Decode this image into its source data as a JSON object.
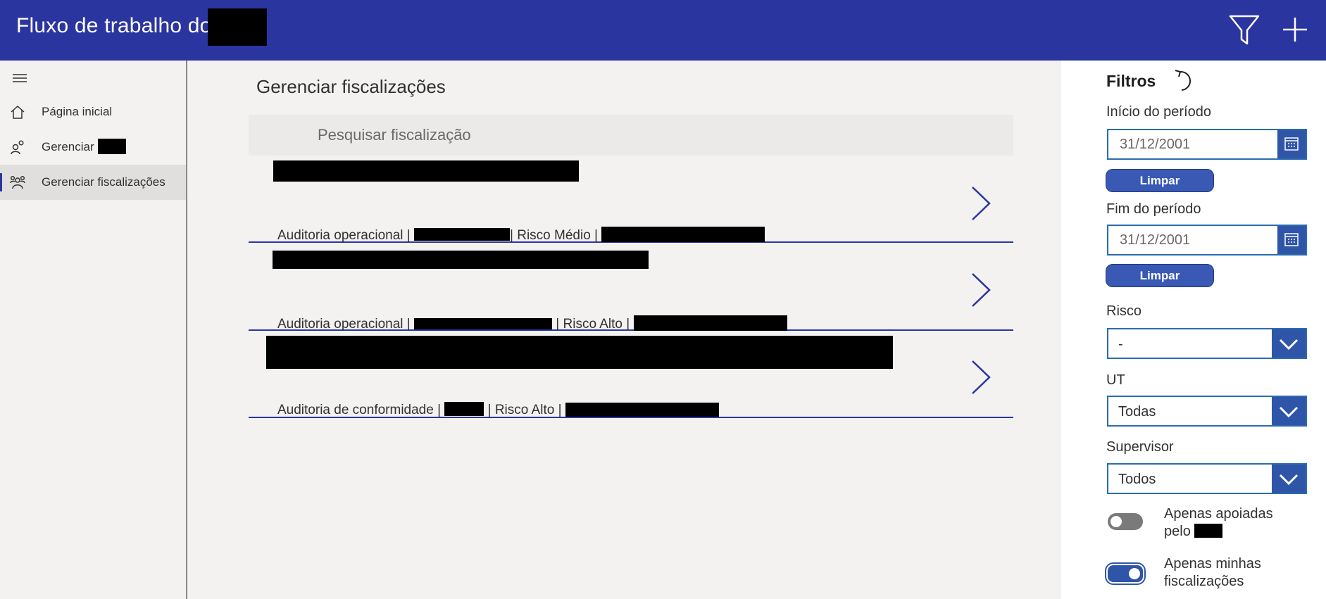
{
  "header": {
    "title": "Fluxo de trabalho do",
    "filter_icon": "filter-icon",
    "add_icon": "plus-icon"
  },
  "sidebar": {
    "menu_icon": "hamburger-icon",
    "items": [
      {
        "label": "Página inicial",
        "icon": "home-icon"
      },
      {
        "label": "Gerenciar",
        "icon": "people-icon"
      },
      {
        "label": "Gerenciar fiscalizações",
        "icon": "team-icon"
      }
    ]
  },
  "main": {
    "title": "Gerenciar fiscalizações",
    "search_placeholder": "Pesquisar fiscalização",
    "items": [
      {
        "type": "Auditoria operacional |",
        "sep": "|",
        "risk": "Risco Médio |"
      },
      {
        "type": "Auditoria operacional |",
        "sep": "|",
        "risk": "Risco Alto |"
      },
      {
        "type": "Auditoria de conformidade |",
        "sep": "|",
        "risk": "Risco Alto |"
      }
    ]
  },
  "filters": {
    "title": "Filtros",
    "start_label": "Início do período",
    "start_value": "31/12/2001",
    "end_label": "Fim do período",
    "end_value": "31/12/2001",
    "clear_label": "Limpar",
    "risk_label": "Risco",
    "risk_value": "-",
    "ut_label": "UT",
    "ut_value": "Todas",
    "supervisor_label": "Supervisor",
    "supervisor_value": "Todos",
    "supported_label": "Apenas apoiadas pelo",
    "supported_on": false,
    "mine_label": "Apenas minhas fiscalizações",
    "mine_on": true
  },
  "colors": {
    "header": "#2b35a0",
    "accent": "#2f55a8",
    "background": "#f3f2f1"
  }
}
